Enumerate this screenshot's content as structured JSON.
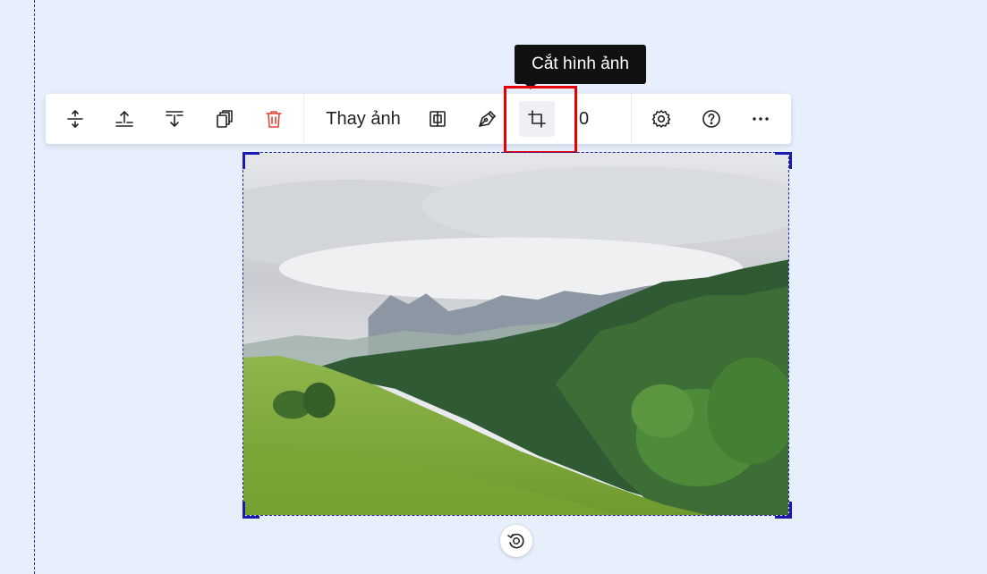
{
  "tooltip": {
    "text": "Cắt hình ảnh"
  },
  "toolbar": {
    "replace_label": "Thay ảnh",
    "partial_label": "0",
    "buttons": [
      {
        "icon": "insert-space-icon"
      },
      {
        "icon": "move-up-icon"
      },
      {
        "icon": "move-down-icon"
      },
      {
        "icon": "duplicate-icon"
      },
      {
        "icon": "delete-icon"
      },
      {
        "icon": "swap-image-icon"
      },
      {
        "icon": "pen-edit-icon"
      },
      {
        "icon": "crop-icon"
      },
      {
        "icon": "settings-icon"
      },
      {
        "icon": "help-icon"
      },
      {
        "icon": "more-icon"
      }
    ]
  },
  "image": {
    "subject": "mountain meadow with pine forest under cloudy sky"
  },
  "colors": {
    "accent": "#1a1ab0",
    "delete": "#e0453a",
    "highlight": "#e60000"
  }
}
